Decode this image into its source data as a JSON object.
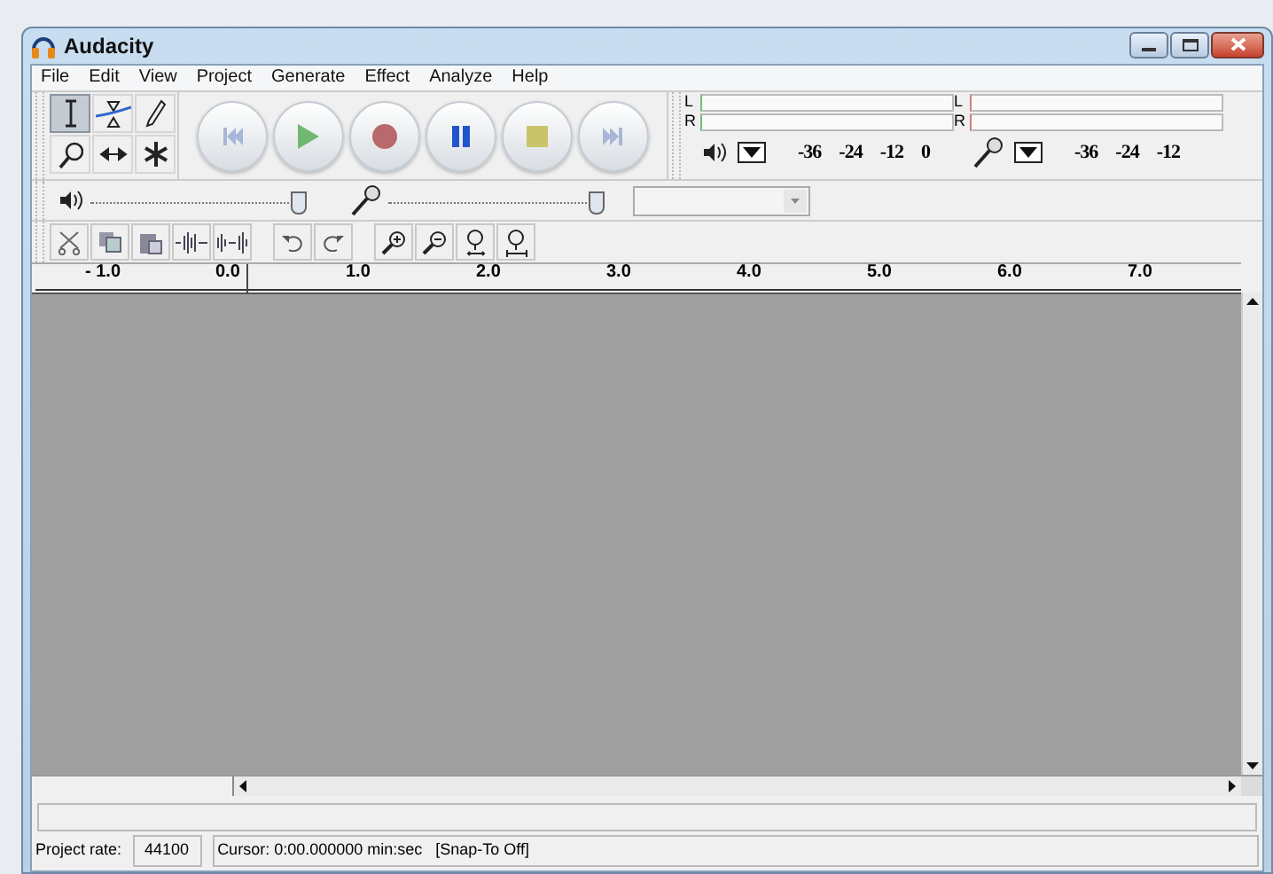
{
  "window": {
    "title": "Audacity"
  },
  "menu": [
    "File",
    "Edit",
    "View",
    "Project",
    "Generate",
    "Effect",
    "Analyze",
    "Help"
  ],
  "tools": [
    {
      "kind": "select",
      "selected": true
    },
    {
      "kind": "envelope",
      "selected": false
    },
    {
      "kind": "draw",
      "selected": false
    },
    {
      "kind": "zoom",
      "selected": false
    },
    {
      "kind": "timeshift",
      "selected": false
    },
    {
      "kind": "multi",
      "selected": false
    }
  ],
  "playback_meter": {
    "channels": [
      "L",
      "R"
    ],
    "scale": [
      "-36",
      "-24",
      "-12",
      "0"
    ]
  },
  "recording_meter": {
    "channels": [
      "L",
      "R"
    ],
    "scale": [
      "-36",
      "-24",
      "-12"
    ]
  },
  "playback_volume": {
    "level": 0.97
  },
  "recording_volume": {
    "level": 0.97
  },
  "ruler": [
    "- 1.0",
    "0.0",
    "1.0",
    "2.0",
    "3.0",
    "4.0",
    "5.0",
    "6.0",
    "7.0"
  ],
  "status_bar": {
    "rate_label": "Project rate:",
    "rate_value": "44100",
    "cursor": "Cursor: 0:00.000000 min:sec   [Snap-To Off]"
  }
}
